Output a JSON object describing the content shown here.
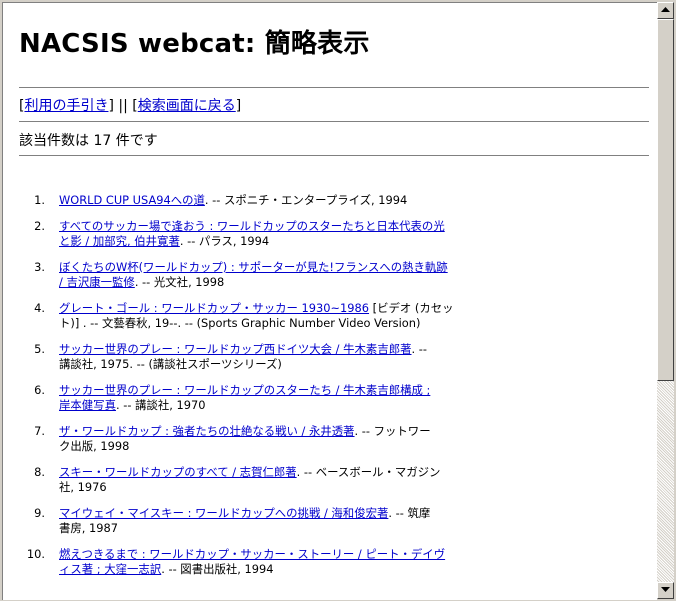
{
  "page_title": "NACSIS webcat: 簡略表示",
  "nav": {
    "open_bracket_1": "[",
    "help_link": "利用の手引き",
    "separator": "] || [",
    "search_link": "検索画面に戻る",
    "close_bracket_2": "]"
  },
  "result_count_text": "該当件数は 17 件です",
  "results": [
    {
      "num": "1.",
      "link": [
        "WORLD CUP USA94への道"
      ],
      "rest": ". -- スポニチ・エンタープライズ, 1994",
      "extra": []
    },
    {
      "num": "2.",
      "link": [
        "すべてのサッカー場で逢おう : ワールドカップのスターたちと日本代表の光",
        "と影 / 加部究, 伯井寛著"
      ],
      "rest": ". -- パラス, 1994",
      "extra": []
    },
    {
      "num": "3.",
      "link": [
        "ぼくたちのW杯(ワールドカップ) : サポーターが見た!フランスへの熱き軌跡",
        "/ 吉沢康一監修"
      ],
      "rest": ". -- 光文社, 1998",
      "extra": []
    },
    {
      "num": "4.",
      "link": [
        "グレート・ゴール : ワールドカップ・サッカー 1930~1986"
      ],
      "rest": " [ビデオ (カセッ",
      "extra": [
        "ト)] . -- 文藝春秋, 19--. -- (Sports Graphic Number Video Version)"
      ]
    },
    {
      "num": "5.",
      "link": [
        "サッカー世界のプレー : ワールドカップ西ドイツ大会 / 牛木素吉郎著"
      ],
      "rest": ". --",
      "extra": [
        "講談社, 1975. -- (講談社スポーツシリーズ)"
      ]
    },
    {
      "num": "6.",
      "link": [
        "サッカー世界のプレー : ワールドカップのスターたち / 牛木素吉郎構成 ;",
        "岸本健写真"
      ],
      "rest": ". -- 講談社, 1970",
      "extra": []
    },
    {
      "num": "7.",
      "link": [
        "ザ・ワールドカップ : 強者たちの壮絶なる戦い / 永井透著"
      ],
      "rest": ". -- フットワー",
      "extra": [
        "ク出版, 1998"
      ]
    },
    {
      "num": "8.",
      "link": [
        "スキー・ワールドカップのすべて / 志賀仁郎著"
      ],
      "rest": ". -- ベースボール・マガジン",
      "extra": [
        "社, 1976"
      ]
    },
    {
      "num": "9.",
      "link": [
        "マイウェイ・マイスキー : ワールドカップへの挑戦 / 海和俊宏著"
      ],
      "rest": ". -- 筑摩",
      "extra": [
        "書房, 1987"
      ]
    },
    {
      "num": "10.",
      "link": [
        "燃えつきるまで : ワールドカップ・サッカー・ストーリー / ピート・デイヴ",
        "ィス著 ; 大窪一志訳"
      ],
      "rest": ". -- 図書出版社, 1994",
      "extra": []
    }
  ],
  "scrollbar": {
    "up_icon": "triangle-up-icon",
    "down_icon": "triangle-down-icon",
    "scroll_position_fraction": 0.0
  }
}
